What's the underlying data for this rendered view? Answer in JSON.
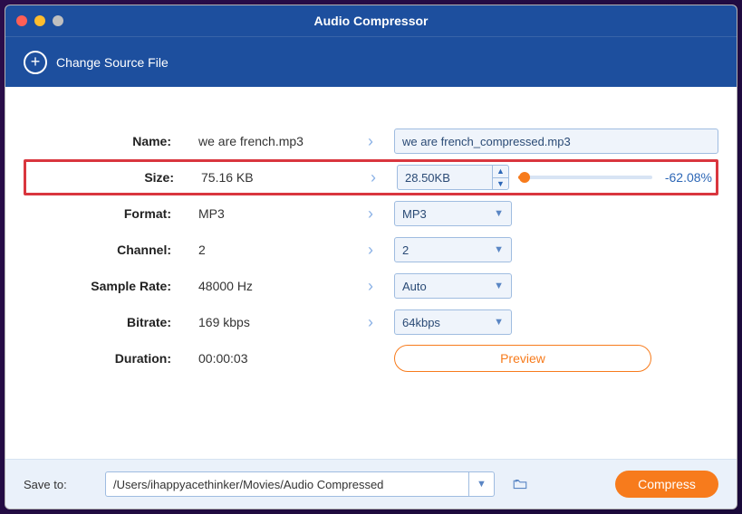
{
  "window": {
    "title": "Audio Compressor"
  },
  "toolbar": {
    "change_source": "Change Source File"
  },
  "rows": {
    "name": {
      "label": "Name:",
      "left": "we are french.mp3",
      "right": "we are french_compressed.mp3"
    },
    "size": {
      "label": "Size:",
      "left": "75.16 KB",
      "right": "28.50KB",
      "percent": "-62.08%"
    },
    "format": {
      "label": "Format:",
      "left": "MP3",
      "right": "MP3"
    },
    "channel": {
      "label": "Channel:",
      "left": "2",
      "right": "2"
    },
    "sample_rate": {
      "label": "Sample Rate:",
      "left": "48000 Hz",
      "right": "Auto"
    },
    "bitrate": {
      "label": "Bitrate:",
      "left": "169 kbps",
      "right": "64kbps"
    },
    "duration": {
      "label": "Duration:",
      "left": "00:00:03"
    }
  },
  "buttons": {
    "preview": "Preview",
    "compress": "Compress"
  },
  "footer": {
    "label": "Save to:",
    "path": "/Users/ihappyacethinker/Movies/Audio Compressed"
  }
}
